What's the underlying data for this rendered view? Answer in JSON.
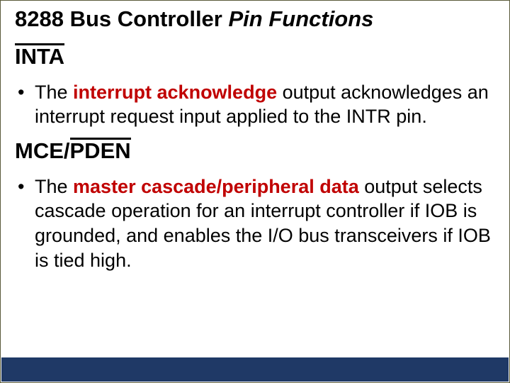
{
  "title": {
    "part1": "8288 Bus Controller ",
    "part2_italic": "Pin Functions"
  },
  "section1": {
    "heading": "INTA",
    "bullet_pre": "The ",
    "bullet_bold": "interrupt acknowledge",
    "bullet_post": " output acknowledges an interrupt request input applied to the INTR pin."
  },
  "section2": {
    "heading_pre": "MCE/",
    "heading_over": "PDEN",
    "bullet_pre": "The ",
    "bullet_bold": "master cascade/peripheral data",
    "bullet_post": " output selects cascade operation for an interrupt controller if IOB is grounded, and enables the I/O bus transceivers if IOB is tied high."
  }
}
